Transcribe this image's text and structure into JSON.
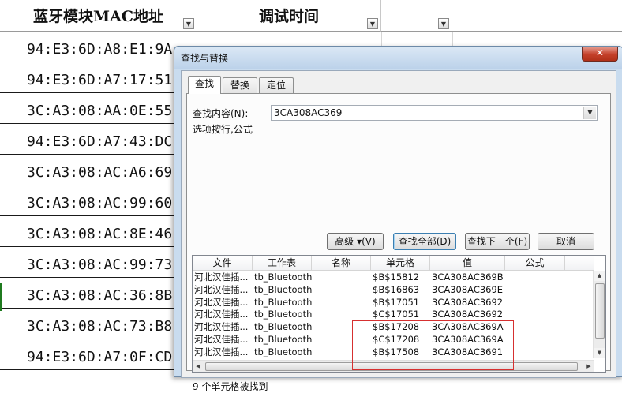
{
  "sheet": {
    "headers": [
      {
        "label": "蓝牙模块MAC地址"
      },
      {
        "label": "调试时间"
      },
      {
        "label": ""
      }
    ],
    "rows": [
      "94:E3:6D:A8:E1:9A",
      "94:E3:6D:A7:17:51",
      "3C:A3:08:AA:0E:55",
      "94:E3:6D:A7:43:DC",
      "3C:A3:08:AC:A6:69",
      "3C:A3:08:AC:99:60",
      "3C:A3:08:AC:8E:46",
      "3C:A3:08:AC:99:73",
      "3C:A3:08:AC:36:8B",
      "3C:A3:08:AC:73:B8",
      "94:E3:6D:A7:0F:CD"
    ],
    "filter_icon": "filter-dropdown-icon"
  },
  "dialog": {
    "title": "查找与替换",
    "close_icon": "close-icon",
    "tabs": [
      "查找",
      "替换",
      "定位"
    ],
    "active_tab": 0,
    "find_label": "查找内容(N):",
    "find_value": "3CA308AC369",
    "options_text": "选项按行,公式",
    "buttons": {
      "advanced": "高级 ▾(V)",
      "find_all": "查找全部(D)",
      "find_next": "查找下一个(F)",
      "cancel": "取消"
    },
    "result_columns": [
      "文件",
      "工作表",
      "名称",
      "单元格",
      "值",
      "公式"
    ],
    "results": [
      {
        "file": "河北汉佳插...",
        "sheet": "tb_Bluetooth",
        "cell": "$B$15812",
        "value": "3CA308AC369B"
      },
      {
        "file": "河北汉佳插...",
        "sheet": "tb_Bluetooth",
        "cell": "$B$16863",
        "value": "3CA308AC369E"
      },
      {
        "file": "河北汉佳插...",
        "sheet": "tb_Bluetooth",
        "cell": "$B$17051",
        "value": "3CA308AC3692"
      },
      {
        "file": "河北汉佳插...",
        "sheet": "tb_Bluetooth",
        "cell": "$C$17051",
        "value": "3CA308AC3692"
      },
      {
        "file": "河北汉佳插...",
        "sheet": "tb_Bluetooth",
        "cell": "$B$17208",
        "value": "3CA308AC369A"
      },
      {
        "file": "河北汉佳插...",
        "sheet": "tb_Bluetooth",
        "cell": "$C$17208",
        "value": "3CA308AC369A"
      },
      {
        "file": "河北汉佳插...",
        "sheet": "tb_Bluetooth",
        "cell": "$B$17508",
        "value": "3CA308AC3691"
      }
    ],
    "status": "9 个单元格被找到"
  },
  "colors": {
    "dialog_frame": "#c9dcef",
    "highlight_box": "#d63030",
    "close_button": "#c4402a"
  }
}
